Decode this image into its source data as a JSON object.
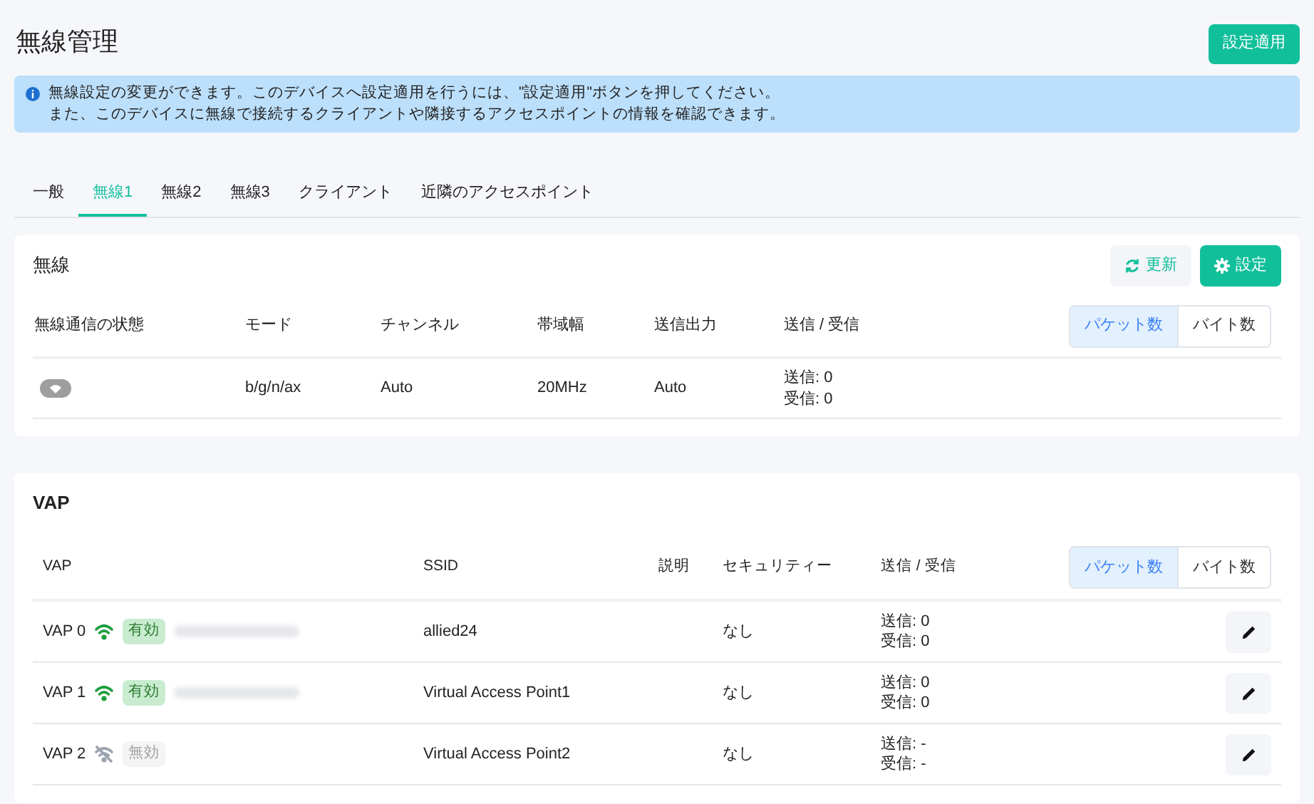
{
  "page": {
    "title": "無線管理",
    "apply_button": "設定適用"
  },
  "notice": {
    "lines": [
      "無線設定の変更ができます。このデバイスへ設定適用を行うには、\"設定適用\"ボタンを押してください。",
      "また、このデバイスに無線で接続するクライアントや隣接するアクセスポイントの情報を確認できます。"
    ]
  },
  "tabs": [
    {
      "label": "一般",
      "selected": false
    },
    {
      "label": "無線1",
      "selected": true
    },
    {
      "label": "無線2",
      "selected": false
    },
    {
      "label": "無線3",
      "selected": false
    },
    {
      "label": "クライアント",
      "selected": false
    },
    {
      "label": "近隣のアクセスポイント",
      "selected": false
    }
  ],
  "radio": {
    "title": "無線",
    "refresh_button": "更新",
    "settings_button": "設定",
    "columns": [
      "無線通信の状態",
      "モード",
      "チャンネル",
      "帯域幅",
      "送信出力",
      "送信 / 受信"
    ],
    "toggle": [
      {
        "label": "パケット数",
        "selected": true
      },
      {
        "label": "バイト数",
        "selected": false
      }
    ],
    "row": {
      "on": false,
      "mode": "b/g/n/ax",
      "channel": "Auto",
      "bandwidth": "20MHz",
      "power": "Auto",
      "tx": "送信: 0",
      "rx": "受信: 0"
    }
  },
  "vap": {
    "title": "VAP",
    "columns": [
      "VAP",
      "SSID",
      "説明",
      "セキュリティー",
      "送信 / 受信"
    ],
    "toggle": [
      {
        "label": "パケット数",
        "selected": true
      },
      {
        "label": "バイト数",
        "selected": false
      }
    ],
    "rows": [
      {
        "name": "VAP 0",
        "enabled": true,
        "status": "有効",
        "ssid": "allied24",
        "security": "なし",
        "tx": "送信: 0",
        "rx": "受信: 0"
      },
      {
        "name": "VAP 1",
        "enabled": true,
        "status": "有効",
        "ssid": "Virtual Access Point1",
        "security": "なし",
        "tx": "送信: 0",
        "rx": "受信: 0"
      },
      {
        "name": "VAP 2",
        "enabled": false,
        "status": "無効",
        "ssid": "Virtual Access Point2",
        "security": "なし",
        "tx": "送信: -",
        "rx": "受信: -"
      }
    ]
  }
}
